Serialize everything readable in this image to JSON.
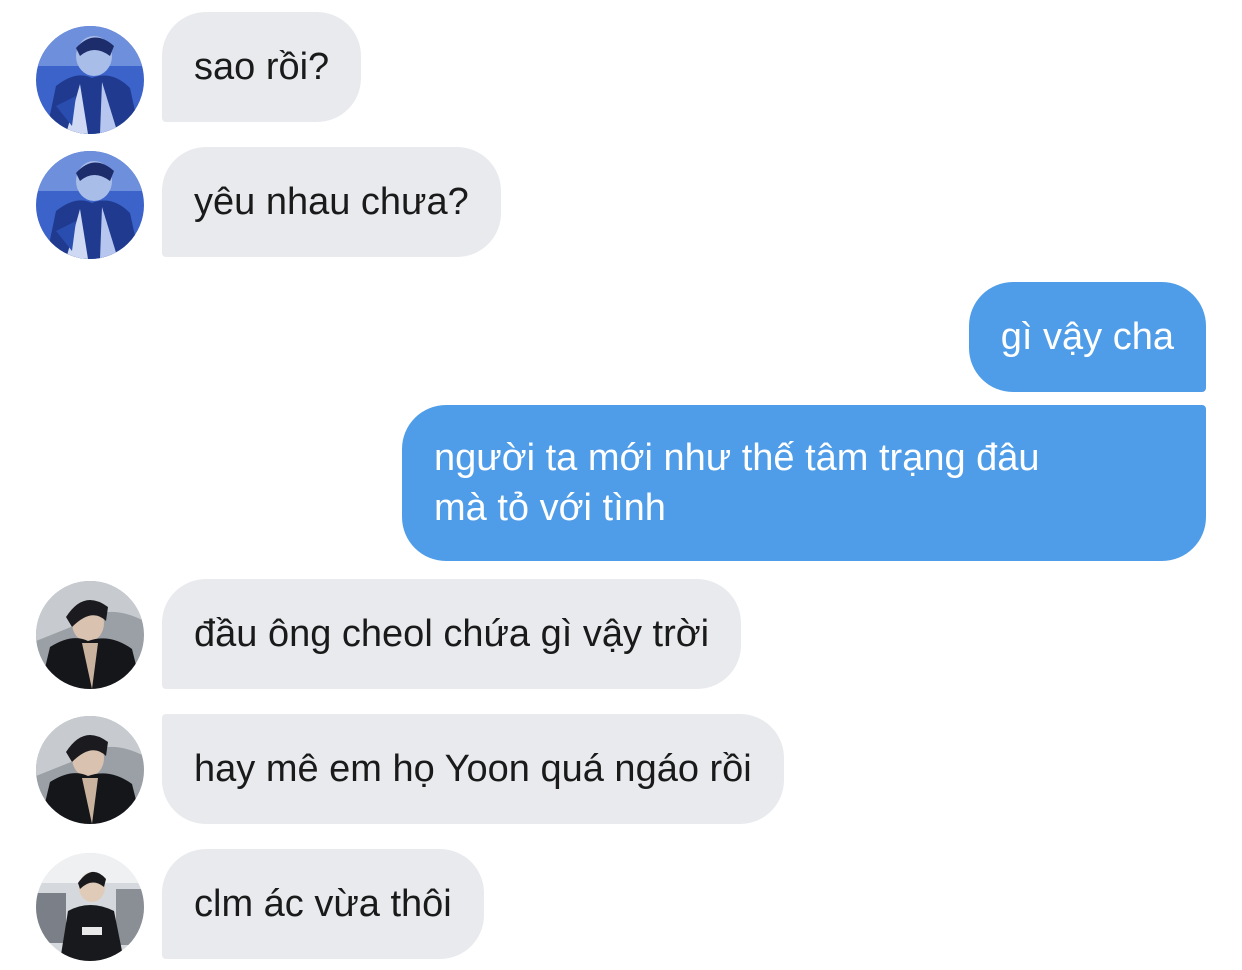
{
  "messages": [
    {
      "sender": "them",
      "avatar": "avatar-blue-jacket",
      "text": "sao rồi?"
    },
    {
      "sender": "them",
      "avatar": "avatar-blue-jacket",
      "text": "yêu nhau chưa?"
    },
    {
      "sender": "me",
      "text": "gì vậy cha"
    },
    {
      "sender": "me",
      "lines": [
        "người ta mới như thế tâm trạng đâu",
        "mà tỏ với tình"
      ]
    },
    {
      "sender": "them",
      "avatar": "avatar-dark-portrait",
      "text": "đầu ông cheol chứa gì vậy trời"
    },
    {
      "sender": "them",
      "avatar": "avatar-dark-portrait",
      "text": "hay mê em họ Yoon quá ngáo rồi"
    },
    {
      "sender": "them",
      "avatar": "avatar-street-photo",
      "text": "clm ác vừa thôi"
    }
  ],
  "colors": {
    "incoming_bubble": "#e8eaee",
    "outgoing_bubble": "#4f9de8",
    "incoming_text": "#1a1a1a",
    "outgoing_text": "#ffffff"
  }
}
